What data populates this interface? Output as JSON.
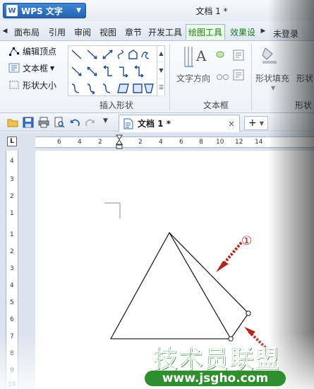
{
  "app": {
    "menu_button": "WPS 文字",
    "logo_letter": "W",
    "document_title": "文档 1 *"
  },
  "ribbon_tabs": [
    "面布局",
    "引用",
    "审阅",
    "视图",
    "章节",
    "开发工具",
    "绘图工具",
    "效果设"
  ],
  "login": "未登录",
  "ribbon": {
    "edit_vertices": "编辑顶点",
    "text_box": "文本框",
    "shape_size": "形状大小",
    "insert_shapes_group": "插入形状",
    "text_direction": "文字方向",
    "textbox_group": "文本框",
    "shape_fill": "形状填充",
    "shape_outline_partial": "形状",
    "shape_style_partial": "形状"
  },
  "doc_tab": {
    "label": "文档 1 *"
  },
  "ruler": {
    "h_labels": [
      "6",
      "4",
      "2",
      "2",
      "4",
      "6",
      "8",
      "10",
      "12",
      "14"
    ],
    "v_labels": [
      "4",
      "3",
      "2",
      "1",
      "1",
      "2",
      "3",
      "4",
      "5",
      "6",
      "7",
      "8",
      "9",
      "10"
    ]
  },
  "annotation": {
    "marker": "①"
  },
  "watermark": {
    "brand": "技术员联盟",
    "url": "www.jsgho.com"
  },
  "colors": {
    "accent_blue": "#2a64b4",
    "active_tab_green": "#1b7a1b",
    "arrow_red": "#b0261e",
    "watermark_green": "#2fa12f"
  }
}
